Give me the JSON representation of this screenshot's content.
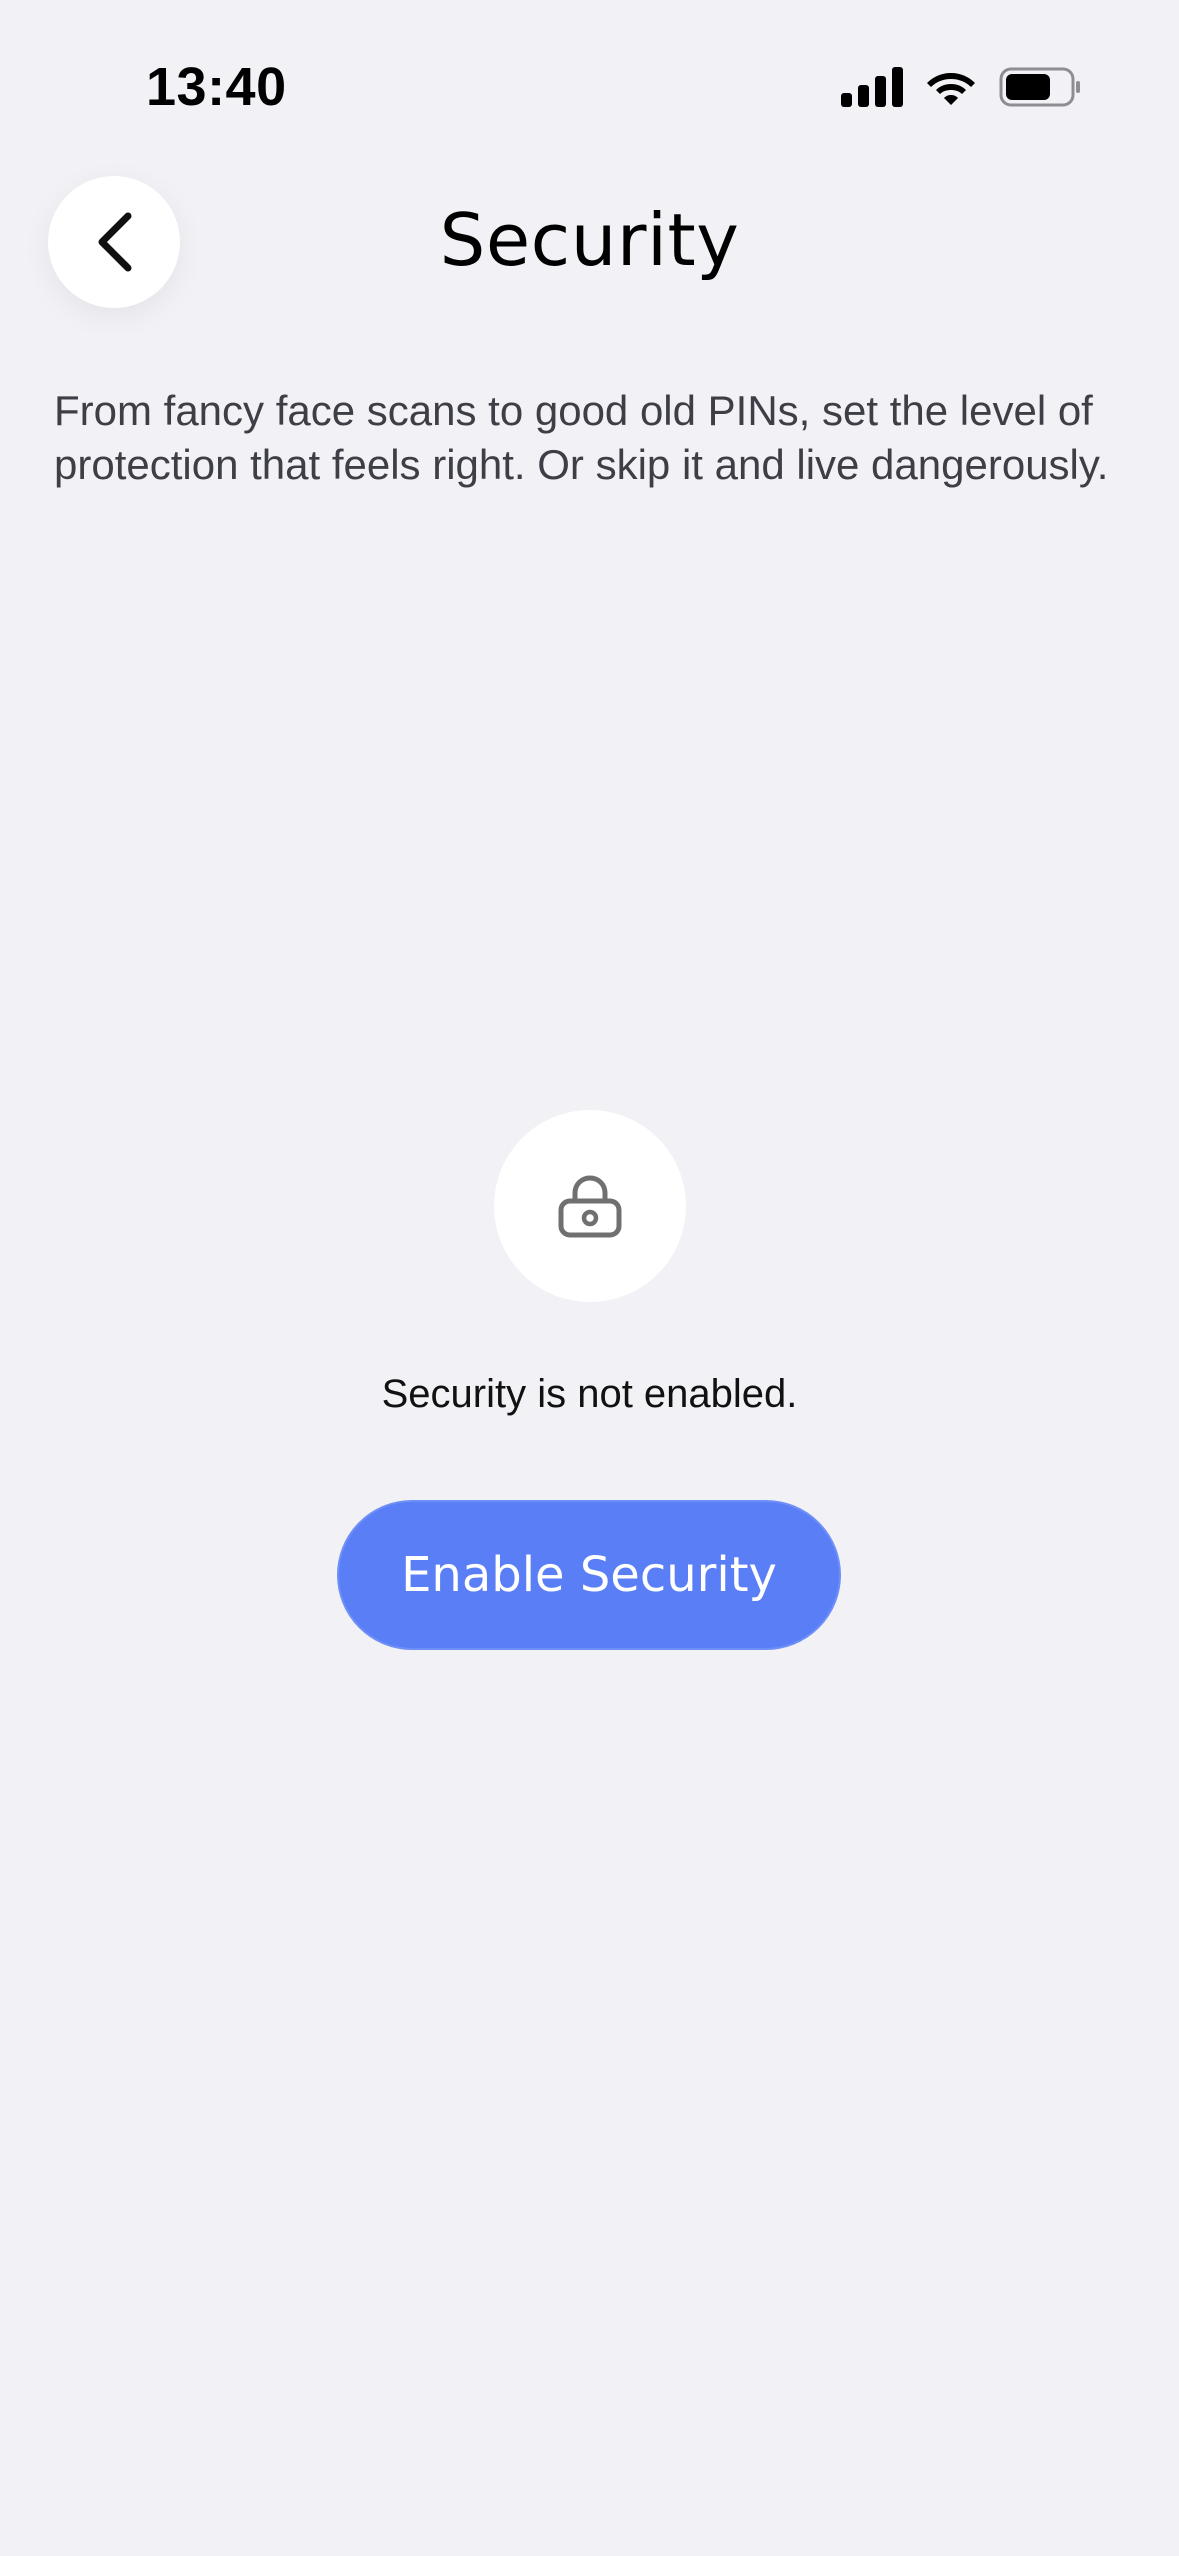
{
  "status_bar": {
    "time": "13:40",
    "icons": [
      "cellular-signal-icon",
      "wifi-icon",
      "battery-icon"
    ]
  },
  "header": {
    "back_icon": "chevron-left-icon",
    "title": "Security"
  },
  "description": "From fancy face scans to good old PINs, set the level of protection that feels right. Or skip it and live dangerously.",
  "empty_state": {
    "icon": "lock-icon",
    "message": "Security is not enabled.",
    "button_label": "Enable Security"
  },
  "colors": {
    "background": "#f1f1f6",
    "accent": "#5a7ef5",
    "text_secondary": "#3e3e46"
  }
}
